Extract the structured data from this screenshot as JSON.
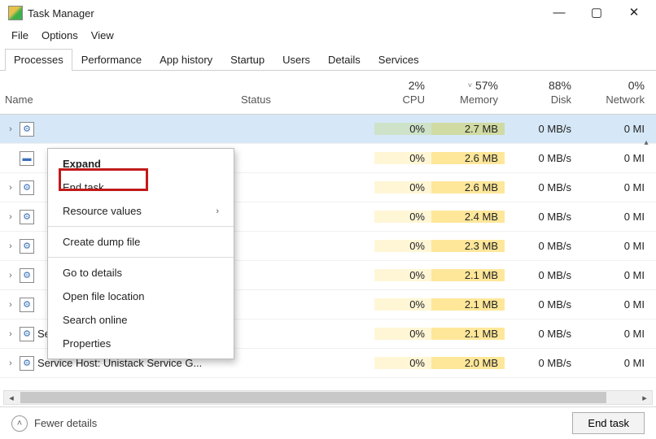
{
  "window": {
    "title": "Task Manager",
    "controls": {
      "minimize": "—",
      "maximize": "▢",
      "close": "✕"
    }
  },
  "menu": {
    "file": "File",
    "options": "Options",
    "view": "View"
  },
  "tabs": {
    "processes": "Processes",
    "performance": "Performance",
    "app_history": "App history",
    "startup": "Startup",
    "users": "Users",
    "details": "Details",
    "services": "Services"
  },
  "columns": {
    "name": "Name",
    "status": "Status",
    "cpu_pct": "2%",
    "cpu": "CPU",
    "mem_pct": "57%",
    "mem": "Memory",
    "disk_pct": "88%",
    "disk": "Disk",
    "net_pct": "0%",
    "net": "Network"
  },
  "rows": [
    {
      "name": "",
      "cpu": "0%",
      "mem": "2.7 MB",
      "disk": "0 MB/s",
      "net": "0 MI"
    },
    {
      "name": "",
      "cpu": "0%",
      "mem": "2.6 MB",
      "disk": "0 MB/s",
      "net": "0 MI"
    },
    {
      "name": "",
      "cpu": "0%",
      "mem": "2.6 MB",
      "disk": "0 MB/s",
      "net": "0 MI"
    },
    {
      "name": "",
      "cpu": "0%",
      "mem": "2.4 MB",
      "disk": "0 MB/s",
      "net": "0 MI"
    },
    {
      "name": "",
      "cpu": "0%",
      "mem": "2.3 MB",
      "disk": "0 MB/s",
      "net": "0 MI"
    },
    {
      "name": "",
      "cpu": "0%",
      "mem": "2.1 MB",
      "disk": "0 MB/s",
      "net": "0 MI"
    },
    {
      "name": "",
      "cpu": "0%",
      "mem": "2.1 MB",
      "disk": "0 MB/s",
      "net": "0 MI"
    },
    {
      "name": "Service Host: Connected Device...",
      "cpu": "0%",
      "mem": "2.1 MB",
      "disk": "0 MB/s",
      "net": "0 MI"
    },
    {
      "name": "Service Host: Unistack Service G...",
      "cpu": "0%",
      "mem": "2.0 MB",
      "disk": "0 MB/s",
      "net": "0 MI"
    }
  ],
  "context_menu": {
    "expand": "Expand",
    "end_task": "End task",
    "resource_values": "Resource values",
    "create_dump": "Create dump file",
    "go_to_details": "Go to details",
    "open_file_location": "Open file location",
    "search_online": "Search online",
    "properties": "Properties"
  },
  "bottom": {
    "fewer": "Fewer details",
    "end_task": "End task"
  }
}
